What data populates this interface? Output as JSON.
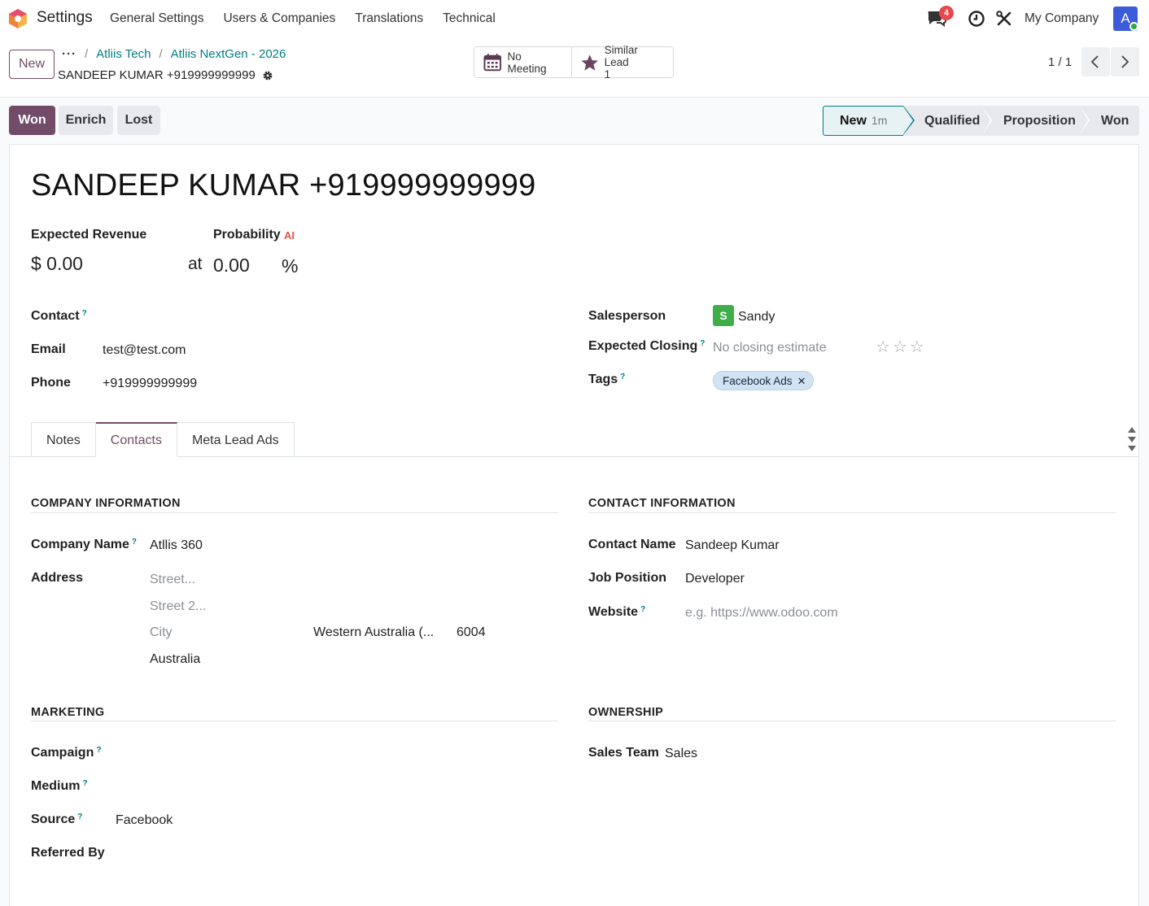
{
  "navbar": {
    "app_title": "Settings",
    "menu": [
      "General Settings",
      "Users & Companies",
      "Translations",
      "Technical"
    ],
    "chat_badge": "4",
    "company": "My Company",
    "avatar_letter": "A"
  },
  "control": {
    "new_label": "New",
    "more": "···",
    "breadcrumbs": [
      "Atliis Tech",
      "Atliis NextGen - 2026"
    ],
    "record_name": "SANDEEP KUMAR +919999999999",
    "smart_buttons": {
      "meeting": "No Meeting",
      "similar_label": "Similar Lead",
      "similar_count": "1"
    },
    "pager": "1 / 1"
  },
  "statusbar": {
    "buttons": [
      "Won",
      "Enrich",
      "Lost"
    ],
    "stages": [
      {
        "label": "New",
        "time": "1m"
      },
      {
        "label": "Qualified"
      },
      {
        "label": "Proposition"
      },
      {
        "label": "Won"
      }
    ],
    "active_stage": "New"
  },
  "lead": {
    "title": "SANDEEP KUMAR +919999999999",
    "expected_revenue_label": "Expected Revenue",
    "expected_revenue": "$ 0.00",
    "probability_label": "Probability",
    "ai_badge": "AI",
    "at": "at",
    "probability": "0.00",
    "percent": "%",
    "contact_label": "Contact",
    "email_label": "Email",
    "email": "test@test.com",
    "phone_label": "Phone",
    "phone": "+919999999999",
    "salesperson_label": "Salesperson",
    "salesperson_initial": "S",
    "salesperson": "Sandy",
    "expected_closing_label": "Expected Closing",
    "expected_closing_placeholder": "No closing estimate",
    "priority_stars": 0,
    "tags_label": "Tags",
    "tag": "Facebook Ads"
  },
  "tabs": [
    "Notes",
    "Contacts",
    "Meta Lead Ads"
  ],
  "active_tab": "Contacts",
  "company_info": {
    "title": "COMPANY INFORMATION",
    "company_name_label": "Company Name",
    "company_name": "Atllis 360",
    "address_label": "Address",
    "street_placeholder": "Street...",
    "street2_placeholder": "Street 2...",
    "city_placeholder": "City",
    "state": "Western Australia (...",
    "zip": "6004",
    "country": "Australia"
  },
  "contact_info": {
    "title": "CONTACT INFORMATION",
    "contact_name_label": "Contact Name",
    "contact_name": "Sandeep Kumar",
    "job_position_label": "Job Position",
    "job_position": "Developer",
    "website_label": "Website",
    "website_placeholder": "e.g. https://www.odoo.com"
  },
  "marketing": {
    "title": "MARKETING",
    "campaign_label": "Campaign",
    "medium_label": "Medium",
    "source_label": "Source",
    "source": "Facebook",
    "referred_label": "Referred By"
  },
  "ownership": {
    "title": "OWNERSHIP",
    "sales_team_label": "Sales Team",
    "sales_team": "Sales"
  },
  "colors": {
    "brand": "#714b67",
    "link": "#017e84",
    "avatar": "#3b5bd9",
    "salesperson_avatar": "#3fae49",
    "badge": "#e5484d"
  }
}
